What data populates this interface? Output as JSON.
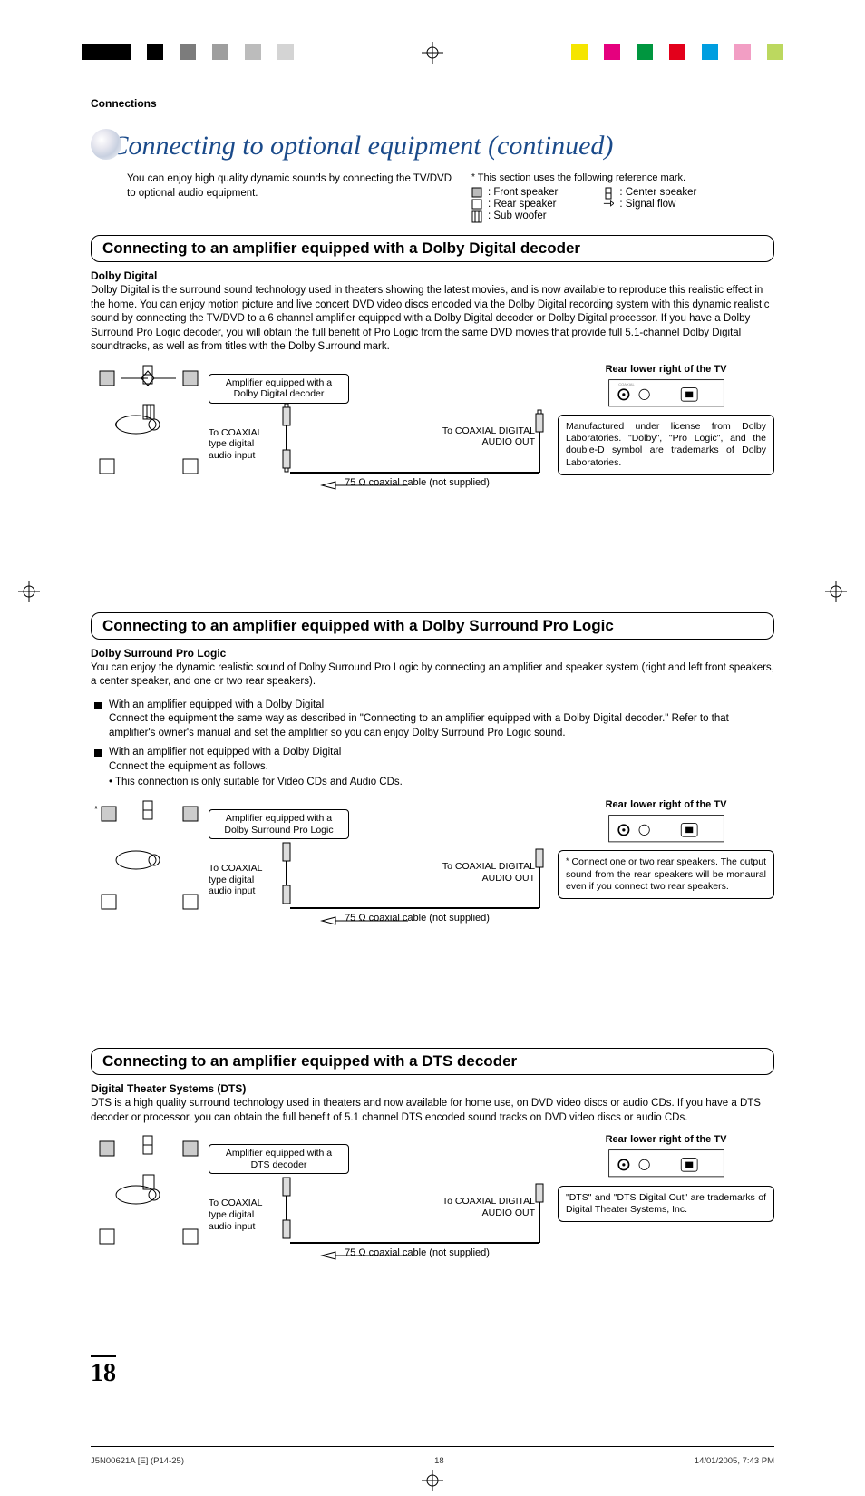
{
  "header_label": "Connections",
  "title": "Connecting to optional equipment (continued)",
  "intro_left": "You can enjoy high quality dynamic sounds by connecting the TV/DVD to optional audio equipment.",
  "intro_right": "This section uses the following reference mark.",
  "legend": {
    "front": ": Front speaker",
    "rear": ": Rear speaker",
    "sub": ": Sub woofer",
    "center": ": Center speaker",
    "signal": ": Signal flow"
  },
  "s1": {
    "banner": "Connecting to an amplifier equipped with a Dolby Digital decoder",
    "subhead": "Dolby Digital",
    "body": "Dolby Digital is the surround sound technology used in theaters showing the latest movies, and is now available to reproduce this realistic effect in the home. You can enjoy motion picture and live concert DVD video discs encoded via the Dolby Digital recording system with this dynamic realistic sound by connecting the TV/DVD to a 6 channel amplifier equipped with a Dolby Digital decoder or Dolby Digital processor. If you have a Dolby Surround Pro Logic decoder, you will obtain the full benefit of Pro Logic from the same DVD movies that provide full 5.1-channel Dolby Digital soundtracks, as well as from titles with the Dolby Surround mark.",
    "ampbox": "Amplifier equipped with a Dolby Digital decoder",
    "coax_in": "To COAXIAL type digital audio input",
    "coax_out": "To COAXIAL DIGITAL AUDIO OUT",
    "cable": "75 Ω coaxial cable (not supplied)",
    "rear_label": "Rear lower right of the TV",
    "note": "Manufactured under license from Dolby Laboratories. \"Dolby\", \"Pro Logic\", and the double-D symbol are trademarks of Dolby Laboratories."
  },
  "s2": {
    "banner": "Connecting to an amplifier equipped with a Dolby Surround Pro Logic",
    "subhead": "Dolby Surround Pro Logic",
    "body": "You can enjoy the dynamic realistic sound of Dolby Surround Pro Logic by connecting an amplifier and speaker system (right and left front speakers, a center speaker, and one or two rear speakers).",
    "b1_head": "With an amplifier equipped with a Dolby Digital",
    "b1_body": "Connect the equipment the same way as described in \"Connecting to an amplifier equipped with a Dolby Digital decoder.\" Refer to that amplifier's owner's manual and set the amplifier so you can enjoy Dolby Surround Pro Logic sound.",
    "b2_head": "With an amplifier not equipped with a Dolby Digital",
    "b2_body": "Connect the equipment as follows.",
    "b2_sub": "• This connection is only suitable for Video CDs and Audio CDs.",
    "ampbox": "Amplifier equipped with a Dolby Surround Pro Logic",
    "coax_in": "To COAXIAL type digital audio input",
    "coax_out": "To COAXIAL DIGITAL AUDIO OUT",
    "cable": "75 Ω coaxial cable (not supplied)",
    "rear_label": "Rear lower right of the TV",
    "note": "Connect one or two rear speakers. The output sound from the rear speakers will be monaural even if you connect two rear speakers."
  },
  "s3": {
    "banner": "Connecting to an amplifier equipped with a DTS decoder",
    "subhead": "Digital Theater Systems (DTS)",
    "body": "DTS is a high quality surround technology used in theaters and now available for home use, on DVD video discs or audio CDs. If you have a DTS decoder or processor, you can obtain the full benefit of 5.1 channel DTS encoded sound tracks on DVD video discs or audio CDs.",
    "ampbox": "Amplifier equipped with a DTS decoder",
    "coax_in": "To COAXIAL type digital audio input",
    "coax_out": "To COAXIAL DIGITAL AUDIO OUT",
    "cable": "75 Ω coaxial cable (not supplied)",
    "rear_label": "Rear lower right of the TV",
    "note": "\"DTS\" and \"DTS Digital Out\" are trademarks of Digital Theater Systems, Inc."
  },
  "pagenum": "18",
  "footer": {
    "left": "J5N00621A [E] (P14-25)",
    "mid": "18",
    "right": "14/01/2005, 7:43 PM"
  }
}
